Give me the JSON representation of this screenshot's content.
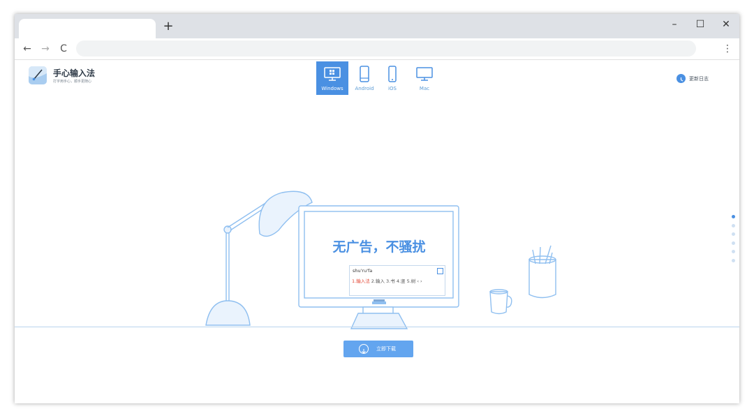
{
  "browser": {
    "new_tab_symbol": "+",
    "back_symbol": "←",
    "forward_symbol": "→",
    "reload_symbol": "C",
    "menu_symbol": "⋮",
    "minimize_symbol": "–",
    "maximize_symbol": "☐",
    "close_symbol": "✕"
  },
  "site": {
    "logo_title": "手心输入法",
    "logo_subtitle": "打字用手心，顺手更随心",
    "platforms": [
      {
        "label": "Windows",
        "icon": "monitor-windows-icon",
        "active": true
      },
      {
        "label": "Android",
        "icon": "android-phone-icon",
        "active": false
      },
      {
        "label": "iOS",
        "icon": "ios-phone-icon",
        "active": false
      },
      {
        "label": "Mac",
        "icon": "mac-monitor-icon",
        "active": false
      }
    ],
    "changelog_label": "更新日志",
    "headline": "无广告，不骚扰",
    "ime": {
      "pinyin": "shu'ru'fa",
      "candidate_1": "1.输入法",
      "candidates_rest": "2.输入  3.书  4.竖  5.树  ‹ ›"
    },
    "download_label": "立即下载",
    "accent_color": "#4a90e2"
  }
}
